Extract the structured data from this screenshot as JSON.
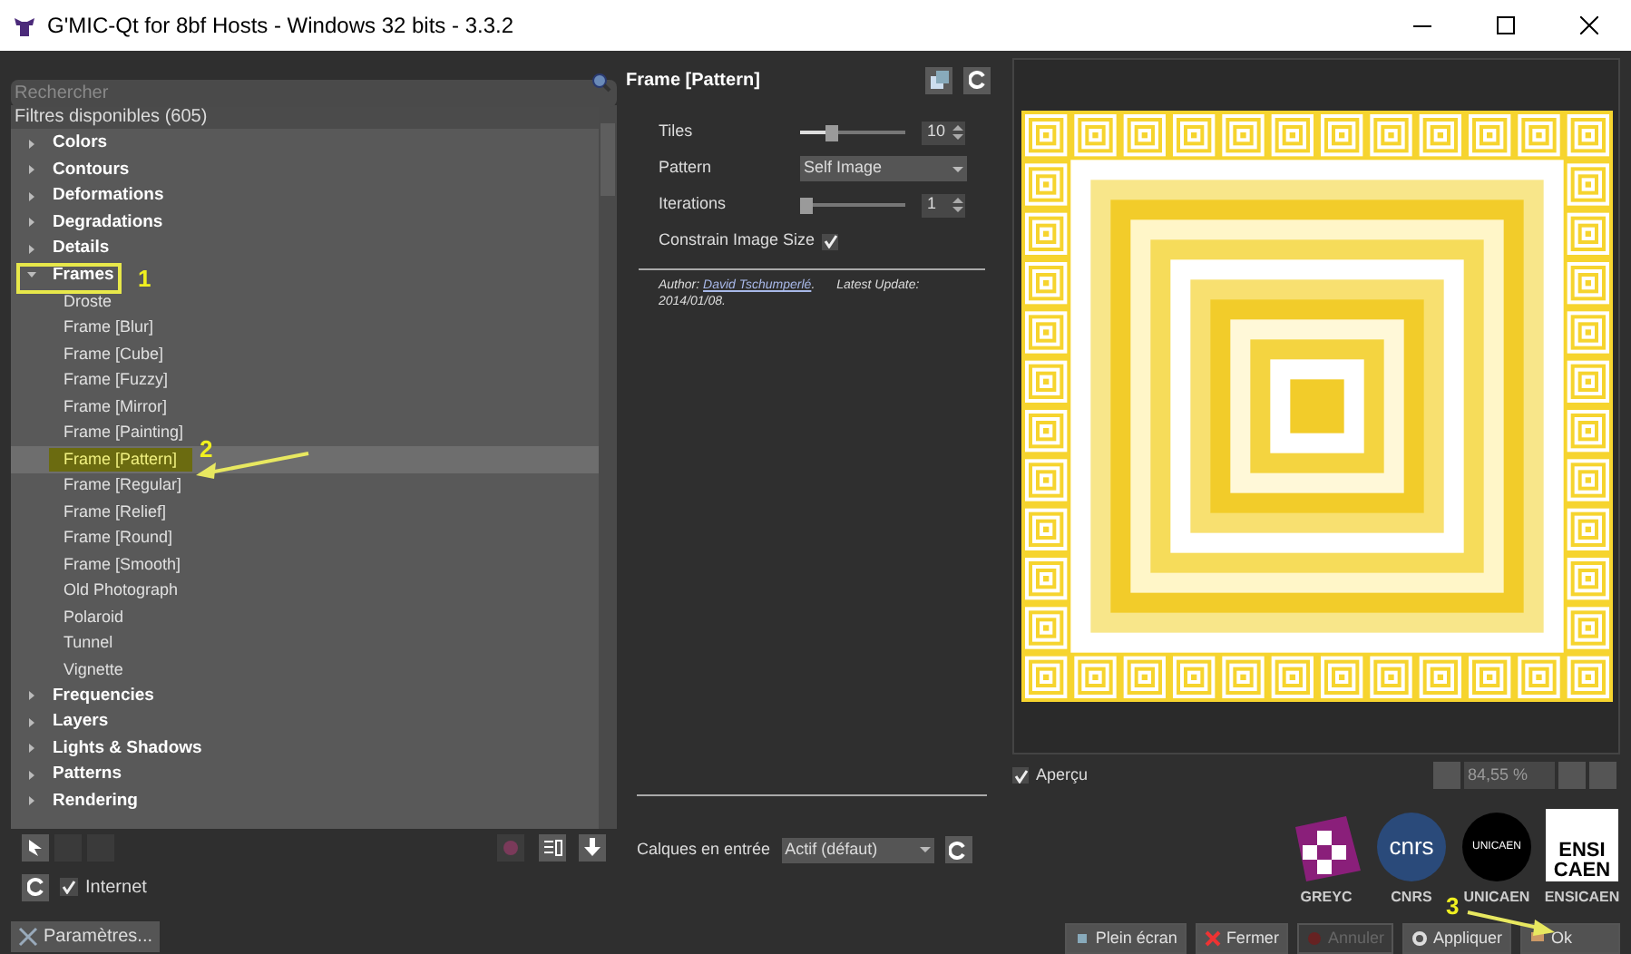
{
  "window": {
    "title": "G'MIC-Qt for 8bf Hosts - Windows 32 bits - 3.3.2"
  },
  "search": {
    "placeholder": "Rechercher"
  },
  "tree": {
    "header": "Filtres disponibles (605)",
    "items": [
      {
        "label": "Colors",
        "expanded": false
      },
      {
        "label": "Contours",
        "expanded": false
      },
      {
        "label": "Deformations",
        "expanded": false
      },
      {
        "label": "Degradations",
        "expanded": false
      },
      {
        "label": "Details",
        "expanded": false
      },
      {
        "label": "Frames",
        "expanded": true,
        "children": [
          {
            "label": "Droste",
            "selected": false
          },
          {
            "label": "Frame [Blur]",
            "selected": false
          },
          {
            "label": "Frame [Cube]",
            "selected": false
          },
          {
            "label": "Frame [Fuzzy]",
            "selected": false
          },
          {
            "label": "Frame [Mirror]",
            "selected": false
          },
          {
            "label": "Frame [Painting]",
            "selected": false
          },
          {
            "label": "Frame [Pattern]",
            "selected": true
          },
          {
            "label": "Frame [Regular]",
            "selected": false
          },
          {
            "label": "Frame [Relief]",
            "selected": false
          },
          {
            "label": "Frame [Round]",
            "selected": false
          },
          {
            "label": "Frame [Smooth]",
            "selected": false
          },
          {
            "label": "Old Photograph",
            "selected": false
          },
          {
            "label": "Polaroid",
            "selected": false
          },
          {
            "label": "Tunnel",
            "selected": false
          },
          {
            "label": "Vignette",
            "selected": false
          }
        ]
      },
      {
        "label": "Frequencies",
        "expanded": false
      },
      {
        "label": "Layers",
        "expanded": false
      },
      {
        "label": "Lights & Shadows",
        "expanded": false
      },
      {
        "label": "Patterns",
        "expanded": false
      },
      {
        "label": "Rendering",
        "expanded": false
      }
    ]
  },
  "internet": {
    "label": "Internet",
    "checked": true
  },
  "settings_button": "Paramètres...",
  "filter": {
    "title": "Frame [Pattern]",
    "params": [
      {
        "kind": "slider",
        "label": "Tiles",
        "level": 0.28,
        "value": "10"
      },
      {
        "kind": "dropdown",
        "label": "Pattern",
        "value": "Self Image"
      },
      {
        "kind": "slider",
        "label": "Iterations",
        "level": 0,
        "value": "1"
      },
      {
        "kind": "checkbox",
        "label": "Constrain Image Size",
        "checked": true
      }
    ],
    "author_label": "Author:",
    "author": "David Tschumperlé",
    "author_end": ".",
    "update_label": "Latest Update:",
    "date": "2014/01/08."
  },
  "input_layers": {
    "label": "Calques en entrée",
    "value": "Actif (défaut)"
  },
  "preview": {
    "label": "Aperçu",
    "checked": true,
    "zoom": "84,55 %"
  },
  "logos": [
    {
      "kind": "greyc",
      "caption": "GREYC"
    },
    {
      "kind": "cnrs",
      "text": "cnrs",
      "caption": "CNRS"
    },
    {
      "kind": "unicaen",
      "text": "UNICAEN",
      "caption": "UNICAEN"
    },
    {
      "kind": "ensicaen",
      "text": "ENSI",
      "text2": "CAEN",
      "caption": "ENSICAEN"
    }
  ],
  "buttons": [
    {
      "kind": "fullscreen",
      "label": "Plein écran",
      "disabled": false
    },
    {
      "kind": "close",
      "label": "Fermer",
      "disabled": false
    },
    {
      "kind": "cancel",
      "label": "Annuler",
      "disabled": true
    },
    {
      "kind": "apply",
      "label": "Appliquer",
      "disabled": false
    },
    {
      "kind": "ok",
      "label": "Ok",
      "disabled": false
    }
  ],
  "annotations": [
    "1",
    "2",
    "3"
  ]
}
